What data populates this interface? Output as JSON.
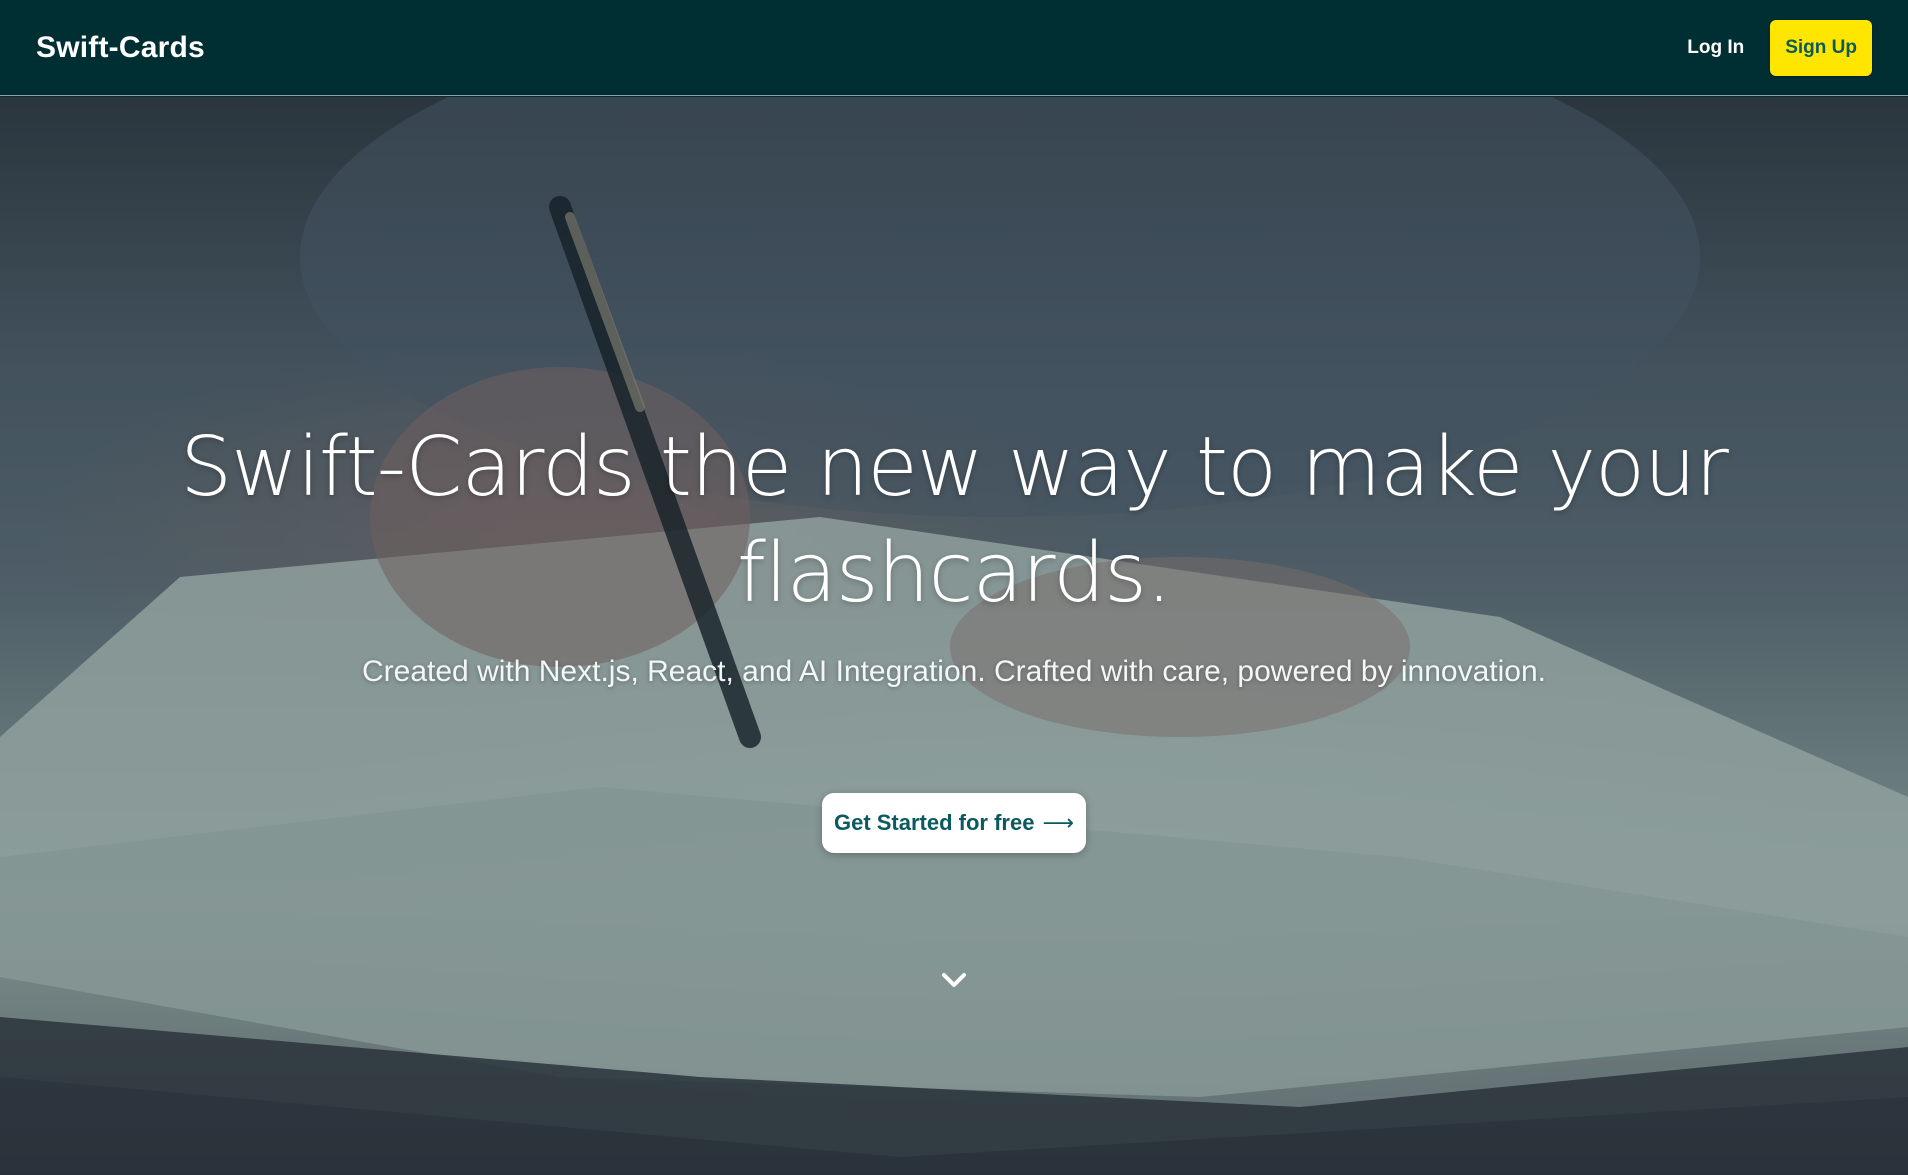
{
  "navbar": {
    "brand": "Swift-Cards",
    "login_label": "Log In",
    "signup_label": "Sign Up"
  },
  "hero": {
    "headline": "Swift-Cards the new way to make your flashcards.",
    "subheadline": "Created with Next.js, React, and AI Integration. Crafted with care, powered by innovation.",
    "cta_label": "Get Started for free",
    "cta_arrow": "⟶",
    "scroll_icon": "chevron-down-icon",
    "background_image": "photo of a hand writing with a pen on paper"
  },
  "colors": {
    "navbar_bg": "#002f33",
    "signup_bg": "#ffe600",
    "accent_text": "#0a5a5e"
  }
}
